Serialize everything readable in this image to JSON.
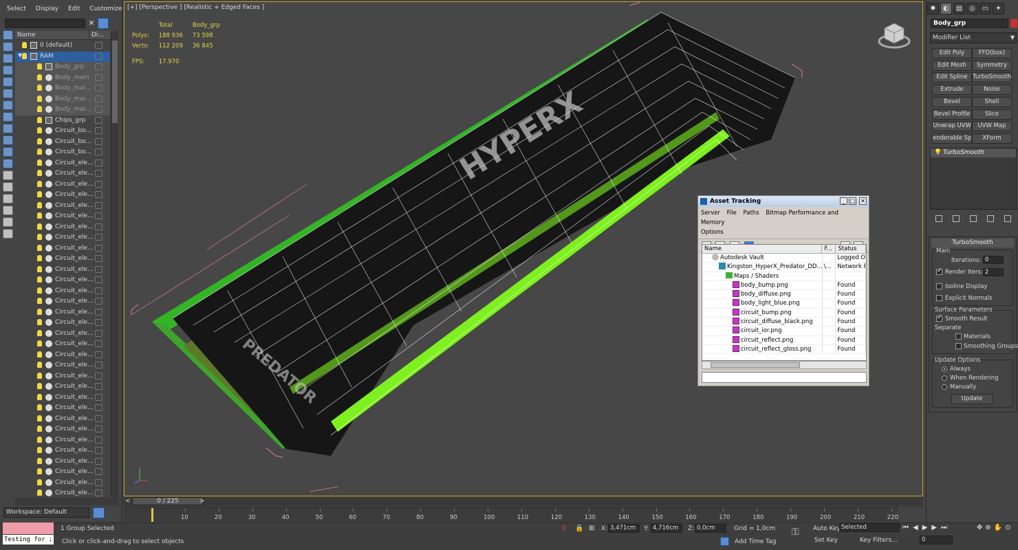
{
  "menu": [
    "Select",
    "Display",
    "Edit",
    "Customize"
  ],
  "explorer": {
    "col_name": "Name",
    "col_display": "Di...",
    "rows": [
      {
        "label": "0 (default)",
        "indent": 1,
        "type": "layer"
      },
      {
        "label": "RAM",
        "indent": 1,
        "type": "layer",
        "selected": true
      },
      {
        "label": "Body_grp",
        "indent": 2,
        "type": "group",
        "highlight": true
      },
      {
        "label": "Body_main",
        "indent": 2,
        "type": "obj",
        "highlight": true
      },
      {
        "label": "Body_mai...",
        "indent": 2,
        "type": "obj",
        "highlight": true
      },
      {
        "label": "Body_mai...",
        "indent": 2,
        "type": "obj",
        "highlight": true
      },
      {
        "label": "Body_mai...",
        "indent": 2,
        "type": "obj",
        "highlight": true
      },
      {
        "label": "Chips_grp",
        "indent": 2,
        "type": "group"
      },
      {
        "label": "Circuit_bo...",
        "indent": 2,
        "type": "obj"
      },
      {
        "label": "Circuit_bo...",
        "indent": 2,
        "type": "obj"
      },
      {
        "label": "Circuit_bo...",
        "indent": 2,
        "type": "obj"
      },
      {
        "label": "Circuit_ele...",
        "indent": 2,
        "type": "obj"
      },
      {
        "label": "Circuit_ele...",
        "indent": 2,
        "type": "obj"
      },
      {
        "label": "Circuit_ele...",
        "indent": 2,
        "type": "obj"
      },
      {
        "label": "Circuit_ele...",
        "indent": 2,
        "type": "obj"
      },
      {
        "label": "Circuit_ele...",
        "indent": 2,
        "type": "obj"
      },
      {
        "label": "Circuit_ele...",
        "indent": 2,
        "type": "obj"
      },
      {
        "label": "Circuit_ele...",
        "indent": 2,
        "type": "obj"
      },
      {
        "label": "Circuit_ele...",
        "indent": 2,
        "type": "obj"
      },
      {
        "label": "Circuit_ele...",
        "indent": 2,
        "type": "obj"
      },
      {
        "label": "Circuit_ele...",
        "indent": 2,
        "type": "obj"
      },
      {
        "label": "Circuit_ele...",
        "indent": 2,
        "type": "obj"
      },
      {
        "label": "Circuit_ele...",
        "indent": 2,
        "type": "obj"
      },
      {
        "label": "Circuit_ele...",
        "indent": 2,
        "type": "obj"
      },
      {
        "label": "Circuit_ele...",
        "indent": 2,
        "type": "obj"
      },
      {
        "label": "Circuit_ele...",
        "indent": 2,
        "type": "obj"
      },
      {
        "label": "Circuit_ele...",
        "indent": 2,
        "type": "obj"
      },
      {
        "label": "Circuit_ele...",
        "indent": 2,
        "type": "obj"
      },
      {
        "label": "Circuit_ele...",
        "indent": 2,
        "type": "obj"
      },
      {
        "label": "Circuit_ele...",
        "indent": 2,
        "type": "obj"
      },
      {
        "label": "Circuit_ele...",
        "indent": 2,
        "type": "obj"
      },
      {
        "label": "Circuit_ele...",
        "indent": 2,
        "type": "obj"
      },
      {
        "label": "Circuit_ele...",
        "indent": 2,
        "type": "obj"
      },
      {
        "label": "Circuit_ele...",
        "indent": 2,
        "type": "obj"
      },
      {
        "label": "Circuit_ele...",
        "indent": 2,
        "type": "obj"
      },
      {
        "label": "Circuit_ele...",
        "indent": 2,
        "type": "obj"
      },
      {
        "label": "Circuit_ele...",
        "indent": 2,
        "type": "obj"
      },
      {
        "label": "Circuit_ele...",
        "indent": 2,
        "type": "obj"
      },
      {
        "label": "Circuit_ele...",
        "indent": 2,
        "type": "obj"
      },
      {
        "label": "Circuit_ele...",
        "indent": 2,
        "type": "obj"
      },
      {
        "label": "Circuit_ele...",
        "indent": 2,
        "type": "obj"
      },
      {
        "label": "Circuit_ele...",
        "indent": 2,
        "type": "obj"
      },
      {
        "label": "Circuit_ele...",
        "indent": 2,
        "type": "obj"
      },
      {
        "label": "Circuit_ele...",
        "indent": 2,
        "type": "obj"
      }
    ],
    "workspace": "Workspace: Default"
  },
  "viewport": {
    "label": "[+] [Perspective ] [Realistic + Edged Faces ]",
    "stats": {
      "col_total": "Total",
      "col_sel": "Body_grp",
      "polys_label": "Polys:",
      "polys_total": "188 936",
      "polys_sel": "73 598",
      "verts_label": "Verts:",
      "verts_total": "112 209",
      "verts_sel": "36 845",
      "fps_label": "FPS:",
      "fps_value": "17.970"
    }
  },
  "command_panel": {
    "object_name": "Body_grp",
    "object_color": "#d42e2e",
    "modifier_list": "Modifier List",
    "buttons": [
      "Edit Poly",
      "FFD(box)",
      "Edit Mesh",
      "Symmetry",
      "Edit Spline",
      "TurboSmooth",
      "Extrude",
      "Noise",
      "Bevel",
      "Shell",
      "Bevel Profile",
      "Slice",
      "Unwrap UVW",
      "UVW Map",
      "enderable Splin",
      "XForm"
    ],
    "stack_item": "TurboSmooth",
    "rollout_title": "TurboSmooth",
    "main_label": "Main",
    "iterations_label": "Iterations:",
    "iterations_value": "0",
    "render_iters_label": "Render Iters:",
    "render_iters_value": "2",
    "isoline_label": "Isoline Display",
    "explicit_label": "Explicit Normals",
    "surface_label": "Surface Parameters",
    "smooth_result_label": "Smooth Result",
    "separate_label": "Separate",
    "materials_label": "Materials",
    "smoothing_groups_label": "Smoothing Groups",
    "update_options_label": "Update Options",
    "always_label": "Always",
    "when_rendering_label": "When Rendering",
    "manually_label": "Manually",
    "update_button": "Update"
  },
  "asset_tracking": {
    "title": "Asset Tracking",
    "menu": [
      "Server",
      "File",
      "Paths",
      "Bitmap Performance and Memory",
      "Options"
    ],
    "col_name": "Name",
    "col_f": "F...",
    "col_status": "Status",
    "rows": [
      {
        "name": "Autodesk Vault",
        "f": "",
        "status": "Logged Out",
        "indent": 1,
        "icon": "vault"
      },
      {
        "name": "Kingston_HyperX_Predator_DD...",
        "f": "\\...",
        "status": "Network Pa",
        "indent": 2,
        "icon": "file"
      },
      {
        "name": "Maps / Shaders",
        "f": "",
        "status": "",
        "indent": 3,
        "icon": "folder"
      },
      {
        "name": "body_bump.png",
        "f": "",
        "status": "Found",
        "indent": 4,
        "icon": "png"
      },
      {
        "name": "body_diffuse.png",
        "f": "",
        "status": "Found",
        "indent": 4,
        "icon": "png"
      },
      {
        "name": "body_light_blue.png",
        "f": "",
        "status": "Found",
        "indent": 4,
        "icon": "png"
      },
      {
        "name": "circuit_bump.png",
        "f": "",
        "status": "Found",
        "indent": 4,
        "icon": "png"
      },
      {
        "name": "circuit_diffuse_black.png",
        "f": "",
        "status": "Found",
        "indent": 4,
        "icon": "png"
      },
      {
        "name": "circuit_ior.png",
        "f": "",
        "status": "Found",
        "indent": 4,
        "icon": "png"
      },
      {
        "name": "circuit_reflect.png",
        "f": "",
        "status": "Found",
        "indent": 4,
        "icon": "png"
      },
      {
        "name": "circuit_reflect_gloss.png",
        "f": "",
        "status": "Found",
        "indent": 4,
        "icon": "png"
      }
    ]
  },
  "timeline": {
    "frame_display": "0 / 225",
    "ticks": [
      "10",
      "20",
      "30",
      "40",
      "50",
      "60",
      "70",
      "80",
      "90",
      "100",
      "110",
      "120",
      "130",
      "140",
      "150",
      "160",
      "170",
      "180",
      "190",
      "200",
      "210",
      "220"
    ]
  },
  "status": {
    "maxscript_input": "Testing for ;",
    "selection": "1 Group Selected",
    "prompt": "Click or click-and-drag to select objects",
    "x_label": "X:",
    "x_value": "3,471cm",
    "y_label": "Y:",
    "y_value": "4,716cm",
    "z_label": "Z:",
    "z_value": "0,0cm",
    "grid": "Grid = 1,0cm",
    "add_time_tag": "Add Time Tag",
    "auto_key": "Auto Key",
    "set_key": "Set Key",
    "key_mode": "Selected",
    "key_filters": "Key Filters...",
    "frame_value": "0"
  }
}
